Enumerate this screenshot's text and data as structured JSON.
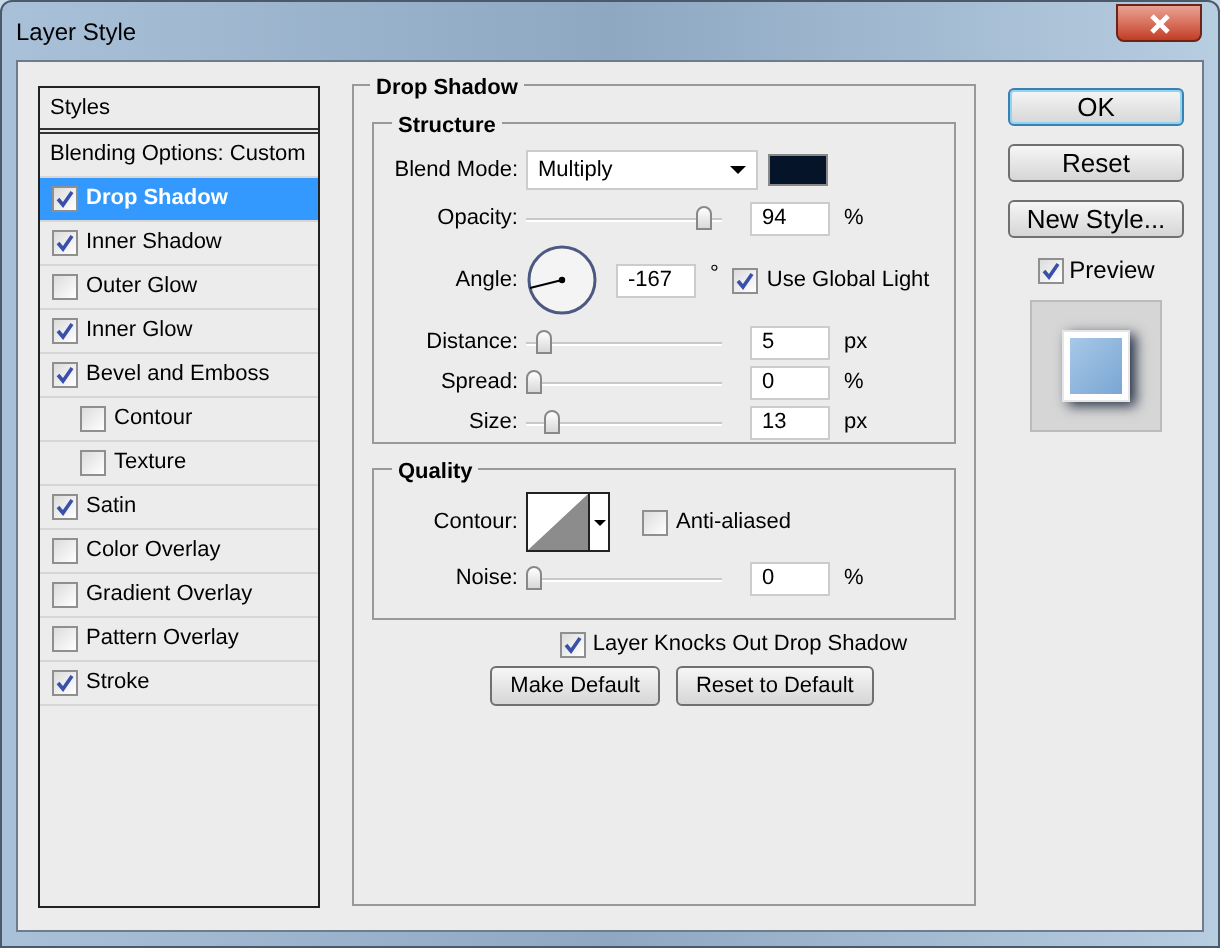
{
  "window": {
    "title": "Layer Style"
  },
  "styles_panel": {
    "header": "Styles",
    "blending_options": "Blending Options: Custom",
    "items": [
      {
        "label": "Drop Shadow",
        "checked": true,
        "selected": true
      },
      {
        "label": "Inner Shadow",
        "checked": true,
        "selected": false
      },
      {
        "label": "Outer Glow",
        "checked": false,
        "selected": false
      },
      {
        "label": "Inner Glow",
        "checked": true,
        "selected": false
      },
      {
        "label": "Bevel and Emboss",
        "checked": true,
        "selected": false,
        "children": [
          {
            "label": "Contour",
            "checked": false,
            "selected": false
          },
          {
            "label": "Texture",
            "checked": false,
            "selected": false
          }
        ]
      },
      {
        "label": "Satin",
        "checked": true,
        "selected": false
      },
      {
        "label": "Color Overlay",
        "checked": false,
        "selected": false
      },
      {
        "label": "Gradient Overlay",
        "checked": false,
        "selected": false
      },
      {
        "label": "Pattern Overlay",
        "checked": false,
        "selected": false
      },
      {
        "label": "Stroke",
        "checked": true,
        "selected": false
      }
    ]
  },
  "section_title": "Drop Shadow",
  "structure": {
    "title": "Structure",
    "rows": [
      {
        "kind": "select",
        "label": "Blend Mode:",
        "value": "Multiply",
        "color": "#06142a"
      },
      {
        "kind": "slider",
        "label": "Opacity:",
        "level": 0.94,
        "value": "94",
        "unit": "%"
      },
      {
        "kind": "angle",
        "label": "Angle:",
        "value": "-167",
        "unit": "°",
        "checkbox": {
          "label": "Use Global Light",
          "checked": true
        }
      },
      {
        "kind": "slider",
        "label": "Distance:",
        "level": 0.05,
        "value": "5",
        "unit": "px"
      },
      {
        "kind": "slider",
        "label": "Spread:",
        "level": 0,
        "value": "0",
        "unit": "%"
      },
      {
        "kind": "slider",
        "label": "Size:",
        "level": 0.1,
        "value": "13",
        "unit": "px"
      }
    ]
  },
  "quality": {
    "title": "Quality",
    "contour_label": "Contour:",
    "anti_aliased": {
      "label": "Anti-aliased",
      "checked": false
    },
    "noise": {
      "label": "Noise:",
      "level": 0,
      "value": "0",
      "unit": "%"
    }
  },
  "knockout": {
    "label": "Layer Knocks Out Drop Shadow",
    "checked": true
  },
  "default_buttons": [
    "Make Default",
    "Reset to Default"
  ],
  "side_buttons": [
    {
      "label": "OK",
      "selected": true
    },
    {
      "label": "Reset",
      "selected": false
    },
    {
      "label": "New Style...",
      "selected": false
    }
  ],
  "preview": {
    "label": "Preview",
    "checked": true
  }
}
